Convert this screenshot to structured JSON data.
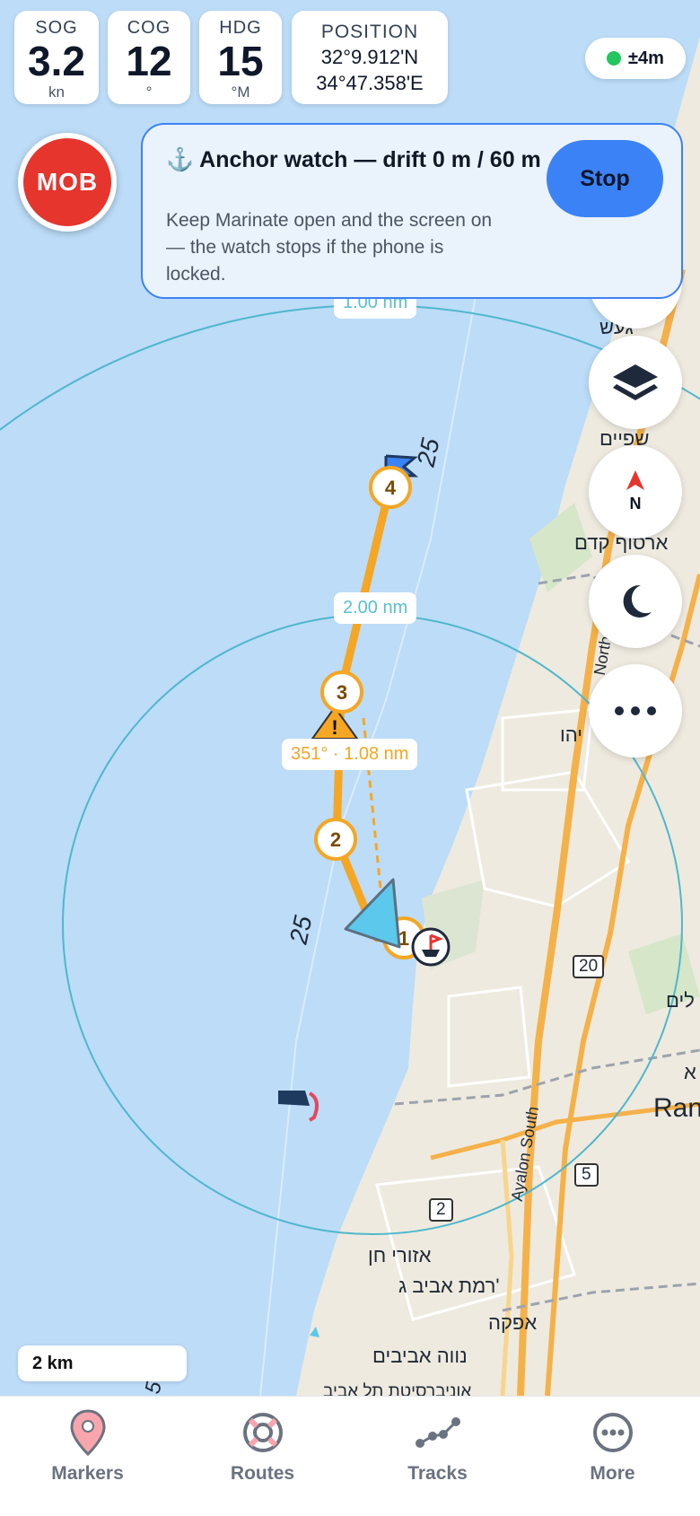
{
  "stats": {
    "sog": {
      "label": "SOG",
      "value": "3.2",
      "unit": "kn"
    },
    "cog": {
      "label": "COG",
      "value": "12",
      "unit": "°"
    },
    "hdg": {
      "label": "HDG",
      "value": "15",
      "unit": "°M"
    },
    "position": {
      "label": "POSITION",
      "lat": "32°9.912'N",
      "lon": "34°47.358'E"
    }
  },
  "gps": {
    "accuracy": "±4m",
    "status_color": "#22c55e"
  },
  "mob": {
    "label": "MOB"
  },
  "anchor_watch": {
    "icon": "anchor-icon",
    "title": "Anchor watch — drift 0 m / 60 m",
    "description": "Keep Marinate open and the screen on — the watch stops if the phone is locked.",
    "stop_label": "Stop"
  },
  "map": {
    "range_labels": [
      "1.00 nm",
      "2.00 nm"
    ],
    "leg_label": "351° · 1.08 nm",
    "route_points": [
      "1",
      "2",
      "3",
      "4"
    ],
    "depth_labels": [
      "25",
      "25",
      "5"
    ],
    "road_numbers": [
      "20",
      "5",
      "2"
    ],
    "road_names": [
      "North",
      "Ayalon South"
    ],
    "place_labels": [
      "געש",
      "שפיים",
      "ארסוף קדם",
      "יהו",
      "לים",
      "א",
      "Ran",
      "אזורי חן",
      "רמת אביב ג'",
      "אפקה",
      "נווה אביבים",
      "אוניברסיטת תל אביב"
    ],
    "scale": "2 km"
  },
  "fabs": [
    "layers-icon",
    "compass-north-icon",
    "night-mode-icon",
    "more-options-icon"
  ],
  "compass_letter": "N",
  "nav": [
    {
      "label": "Markers",
      "icon": "map-pin-icon"
    },
    {
      "label": "Routes",
      "icon": "lifebuoy-icon"
    },
    {
      "label": "Tracks",
      "icon": "track-icon"
    },
    {
      "label": "More",
      "icon": "more-icon"
    }
  ],
  "colors": {
    "accent": "#3b82f6",
    "mob": "#e5352d",
    "route": "#f5a623",
    "range_ring": "#4fb7cc"
  }
}
